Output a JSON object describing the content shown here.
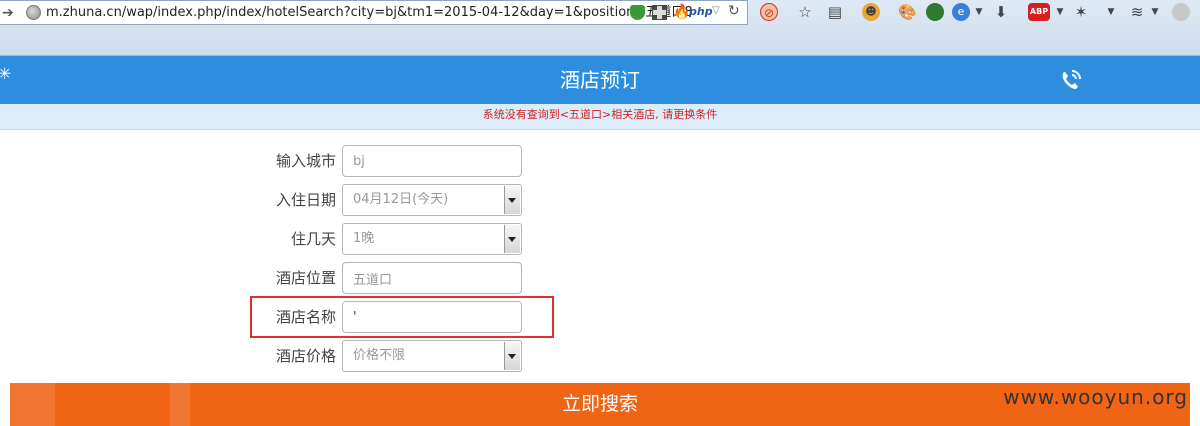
{
  "browser": {
    "url": "m.zhuna.cn/wap/index.php/index/hotelSearch?city=bj&tm1=2015-04-12&day=1&position=五道口8",
    "php_badge": "php"
  },
  "header": {
    "title": "酒店预订"
  },
  "notice": {
    "message": "系统没有查询到<五道口>相关酒店, 请更换条件"
  },
  "form": {
    "city": {
      "label": "输入城市",
      "value": "bj"
    },
    "checkin": {
      "label": "入住日期",
      "selected": "04月12日(今天)"
    },
    "nights": {
      "label": "住几天",
      "selected": "1晚"
    },
    "location": {
      "label": "酒店位置",
      "value": "五道口"
    },
    "hotel_name": {
      "label": "酒店名称",
      "value": "'"
    },
    "price": {
      "label": "酒店价格",
      "selected": "价格不限"
    }
  },
  "search_button": {
    "label": "立即搜索"
  },
  "watermark": "www.wooyun.org",
  "colors": {
    "header_bg": "#2d8ee0",
    "notice_bg": "#dcedf9",
    "notice_text": "#d42020",
    "button_bg": "#f06416",
    "highlight": "#e03030"
  }
}
